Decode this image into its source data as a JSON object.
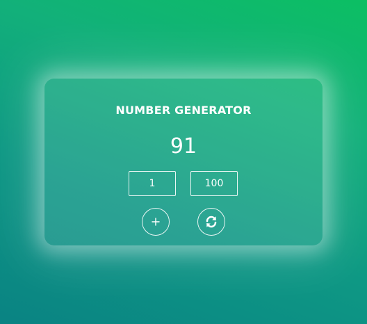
{
  "app": {
    "title": "NUMBER GENERATOR",
    "generated_number": "91"
  },
  "range": {
    "min_value": "1",
    "max_value": "100"
  },
  "actions": {
    "generate_icon": "plus-icon",
    "reset_icon": "refresh-icon"
  },
  "colors": {
    "background_start": "#0cbf63",
    "background_end": "#0a8383",
    "text": "#ffffff"
  }
}
